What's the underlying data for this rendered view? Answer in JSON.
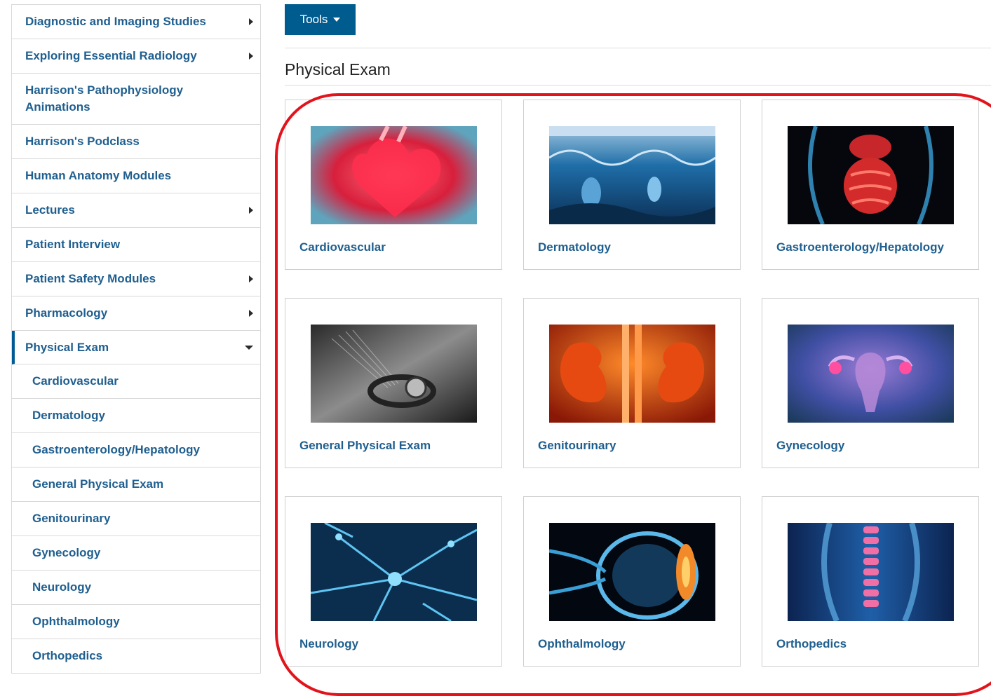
{
  "sidebar": {
    "items": [
      {
        "label": "Diagnostic and Imaging Studies",
        "arrow": "right"
      },
      {
        "label": "Exploring Essential Radiology",
        "arrow": "right"
      },
      {
        "label": "Harrison's Pathophysiology Animations",
        "arrow": "none"
      },
      {
        "label": "Harrison's Podclass",
        "arrow": "none"
      },
      {
        "label": "Human Anatomy Modules",
        "arrow": "none"
      },
      {
        "label": "Lectures",
        "arrow": "right"
      },
      {
        "label": "Patient Interview",
        "arrow": "none"
      },
      {
        "label": "Patient Safety Modules",
        "arrow": "right"
      },
      {
        "label": "Pharmacology",
        "arrow": "right"
      },
      {
        "label": "Physical Exam",
        "arrow": "down",
        "active": true
      }
    ],
    "subitems": [
      {
        "label": "Cardiovascular"
      },
      {
        "label": "Dermatology"
      },
      {
        "label": "Gastroenterology/Hepatology"
      },
      {
        "label": "General Physical Exam"
      },
      {
        "label": "Genitourinary"
      },
      {
        "label": "Gynecology"
      },
      {
        "label": "Neurology"
      },
      {
        "label": "Ophthalmology"
      },
      {
        "label": "Orthopedics"
      }
    ]
  },
  "toolbar": {
    "tools_label": "Tools"
  },
  "page": {
    "title": "Physical Exam"
  },
  "cards": [
    {
      "label": "Cardiovascular",
      "image": "heart-image"
    },
    {
      "label": "Dermatology",
      "image": "skin-layers-image"
    },
    {
      "label": "Gastroenterology/Hepatology",
      "image": "digestive-system-image"
    },
    {
      "label": "General Physical Exam",
      "image": "stethoscope-image"
    },
    {
      "label": "Genitourinary",
      "image": "kidneys-image"
    },
    {
      "label": "Gynecology",
      "image": "uterus-image"
    },
    {
      "label": "Neurology",
      "image": "neurons-image"
    },
    {
      "label": "Ophthalmology",
      "image": "eye-image"
    },
    {
      "label": "Orthopedics",
      "image": "spine-image"
    }
  ],
  "colors": {
    "accent": "#005b8f",
    "link": "#1f5f8f",
    "highlight": "#e2131b"
  }
}
